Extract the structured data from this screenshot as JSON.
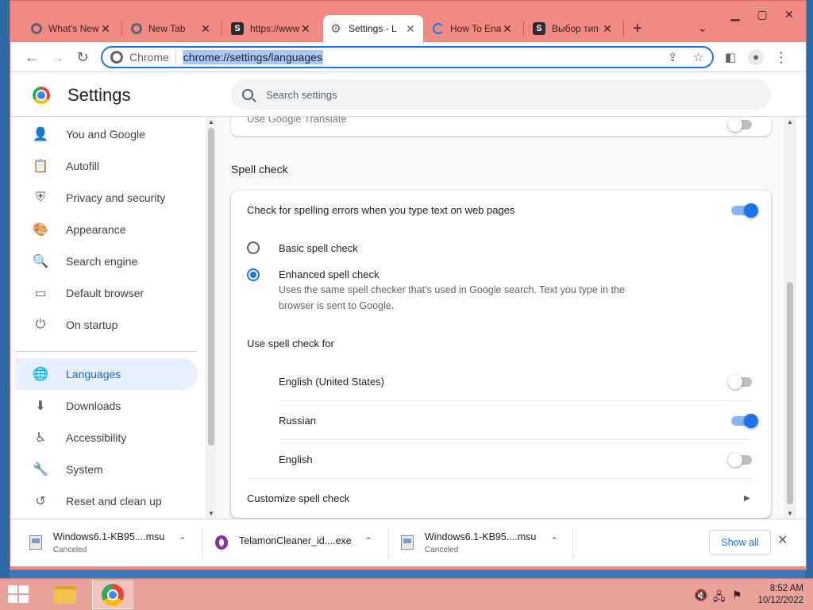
{
  "tabs": [
    {
      "title": "What's New",
      "favicon": "chrome-icon"
    },
    {
      "title": "New Tab",
      "favicon": "chrome-icon"
    },
    {
      "title": "https://www",
      "favicon": "s-icon"
    },
    {
      "title": "Settings - L",
      "favicon": "gear-icon",
      "active": true
    },
    {
      "title": "How To Ena",
      "favicon": "loading-icon"
    },
    {
      "title": "Выбор тип",
      "favicon": "s-icon"
    }
  ],
  "toolbar": {
    "omnibox_label": "Chrome",
    "url": "chrome://settings/languages"
  },
  "settings": {
    "title": "Settings",
    "search_placeholder": "Search settings"
  },
  "sidebar": {
    "items": [
      {
        "label": "You and Google",
        "icon": "person-icon"
      },
      {
        "label": "Autofill",
        "icon": "clipboard-icon"
      },
      {
        "label": "Privacy and security",
        "icon": "shield-icon"
      },
      {
        "label": "Appearance",
        "icon": "palette-icon"
      },
      {
        "label": "Search engine",
        "icon": "search-icon"
      },
      {
        "label": "Default browser",
        "icon": "browser-icon"
      },
      {
        "label": "On startup",
        "icon": "power-icon"
      },
      {
        "label": "Languages",
        "icon": "globe-icon",
        "active": true
      },
      {
        "label": "Downloads",
        "icon": "download-icon"
      },
      {
        "label": "Accessibility",
        "icon": "accessibility-icon"
      },
      {
        "label": "System",
        "icon": "wrench-icon"
      },
      {
        "label": "Reset and clean up",
        "icon": "reset-icon"
      }
    ]
  },
  "main": {
    "prev_row": "Use Google Translate",
    "section_title": "Spell check",
    "spell_check_toggle_label": "Check for spelling errors when you type text on web pages",
    "spell_check_enabled": true,
    "basic_label": "Basic spell check",
    "enhanced_label": "Enhanced spell check",
    "enhanced_desc_1": "Uses the same spell checker that’s used in Google search. Text you type in the",
    "enhanced_desc_2": "browser is sent to Google.",
    "selected_mode": "enhanced",
    "use_for_label": "Use spell check for",
    "languages": [
      {
        "name": "English (United States)",
        "enabled": false
      },
      {
        "name": "Russian",
        "enabled": true
      },
      {
        "name": "English",
        "enabled": false
      }
    ],
    "customize_label": "Customize spell check"
  },
  "downloads": [
    {
      "name": "Windows6.1-KB95....msu",
      "status": "Canceled"
    },
    {
      "name": "TelamonCleaner_id....exe",
      "status": ""
    },
    {
      "name": "Windows6.1-KB95....msu",
      "status": "Canceled"
    }
  ],
  "downloads_bar": {
    "show_all": "Show all"
  },
  "taskbar": {
    "time": "8:52 AM",
    "date": "10/12/2022"
  },
  "colors": {
    "accent": "#1a73e8",
    "window_frame": "#f08a84",
    "active_nav_bg": "#e8f0fe"
  }
}
